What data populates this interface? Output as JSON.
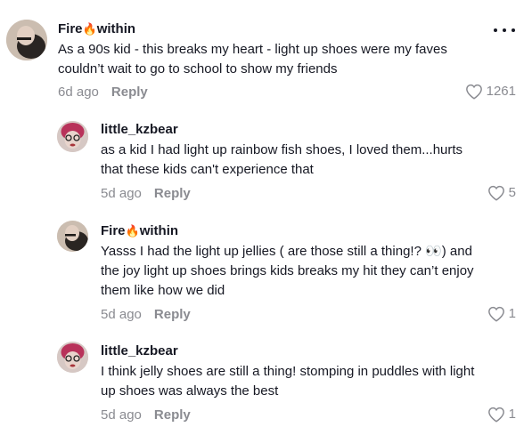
{
  "more_icon": "ellipsis-icon",
  "comments": [
    {
      "username": "Fire",
      "username_suffix": "within",
      "emoji": "🔥",
      "text_lines": [
        "As a 90s kid - this breaks my heart - light up shoes were my faves",
        "couldn’t wait to go to school to show my friends"
      ],
      "time": "6d ago",
      "reply_label": "Reply",
      "likes": "1261"
    },
    {
      "username": "little_kzbear",
      "text_lines": [
        "as a kid I had light up rainbow fish shoes, I loved them...hurts",
        "that these kids can't experience that"
      ],
      "time": "5d ago",
      "reply_label": "Reply",
      "likes": "5"
    },
    {
      "username": "Fire",
      "username_suffix": "within",
      "emoji": "🔥",
      "text_lines": [
        "Yasss I had the light up jellies ( are those still a thing!? 👀) and",
        "the joy light up shoes brings kids breaks my hit they can’t enjoy",
        "them like how we did"
      ],
      "time": "5d ago",
      "reply_label": "Reply",
      "likes": "1"
    },
    {
      "username": "little_kzbear",
      "text_lines": [
        "I think jelly shoes are still a thing! stomping in puddles with light",
        "up shoes was always the best"
      ],
      "time": "5d ago",
      "reply_label": "Reply",
      "likes": "1"
    }
  ],
  "colors": {
    "text": "#161823",
    "muted": "#8a8b91",
    "background": "#ffffff"
  }
}
